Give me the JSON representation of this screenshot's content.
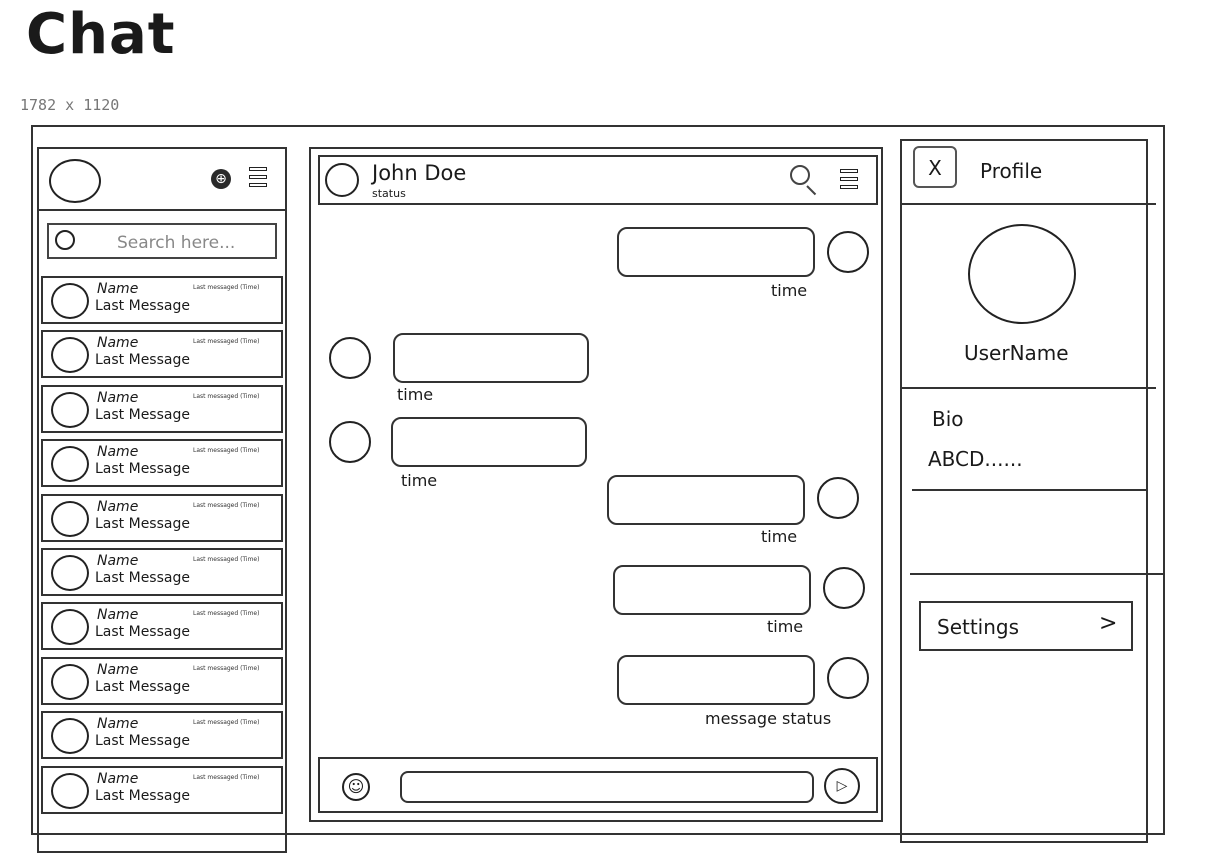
{
  "title": "Chat",
  "dimensions_label": "1782 x 1120",
  "sidebar": {
    "search_placeholder": "Search here...",
    "contacts": [
      {
        "name": "Name",
        "last_message": "Last Message",
        "time": "Last messaged (Time)"
      },
      {
        "name": "Name",
        "last_message": "Last Message",
        "time": "Last messaged (Time)"
      },
      {
        "name": "Name",
        "last_message": "Last Message",
        "time": "Last messaged (Time)"
      },
      {
        "name": "Name",
        "last_message": "Last Message",
        "time": "Last messaged (Time)"
      },
      {
        "name": "Name",
        "last_message": "Last Message",
        "time": "Last messaged (Time)"
      },
      {
        "name": "Name",
        "last_message": "Last Message",
        "time": "Last messaged (Time)"
      },
      {
        "name": "Name",
        "last_message": "Last Message",
        "time": "Last messaged (Time)"
      },
      {
        "name": "Name",
        "last_message": "Last Message",
        "time": "Last messaged (Time)"
      },
      {
        "name": "Name",
        "last_message": "Last Message",
        "time": "Last messaged (Time)"
      },
      {
        "name": "Name",
        "last_message": "Last Message",
        "time": "Last messaged (Time)"
      }
    ],
    "icons": [
      "globe-icon",
      "menu-icon"
    ]
  },
  "chat": {
    "contact_name": "John Doe",
    "contact_status": "status",
    "messages": [
      {
        "side": "right",
        "label": "time"
      },
      {
        "side": "left",
        "label": "time"
      },
      {
        "side": "left",
        "label": "time"
      },
      {
        "side": "right",
        "label": "time"
      },
      {
        "side": "right",
        "label": "time"
      },
      {
        "side": "right",
        "label": "message status"
      }
    ],
    "icons": [
      "search-icon",
      "menu-icon",
      "emoji-icon",
      "send-icon"
    ]
  },
  "profile": {
    "close_glyph": "X",
    "title": "Profile",
    "username": "UserName",
    "bio_label": "Bio",
    "bio_text": "ABCD......",
    "settings_label": "Settings",
    "settings_chevron": ">"
  }
}
